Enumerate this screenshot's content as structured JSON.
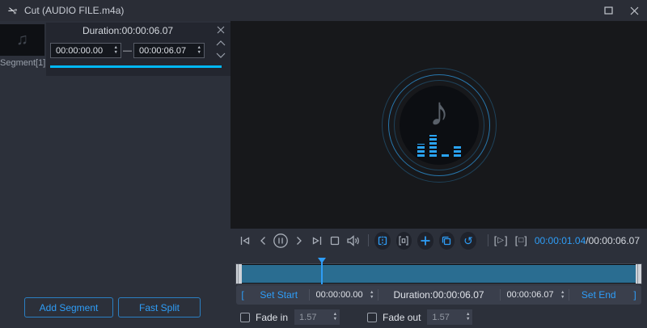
{
  "title_bar": {
    "title": "Cut (AUDIO FILE.m4a)"
  },
  "icons": {
    "scissors": "✂",
    "thumb_note": "♫",
    "preview_note": "♪",
    "spinner_up": "▲",
    "spinner_down": "▼",
    "range_dash": "—",
    "reset": "↺",
    "bracket_open": "[",
    "bracket_close": "]",
    "play_triangle": "▷",
    "stop_square": "□"
  },
  "segment_panel": {
    "segment_label": "Segment[1]",
    "duration_label": "Duration:00:00:06.07",
    "start_value": "00:00:00.00",
    "end_value": "00:00:06.07",
    "add_segment_button": "Add Segment",
    "fast_split_button": "Fast Split"
  },
  "player": {
    "current_time": "00:00:01.04",
    "time_separator": "/",
    "total_time": "00:00:06.07",
    "playhead_percent": 21
  },
  "trim_bar": {
    "set_start_button": "Set Start",
    "start_value": "00:00:00.00",
    "duration_label": "Duration:00:00:06.07",
    "end_value": "00:00:06.07",
    "set_end_button": "Set End"
  },
  "fade_controls": {
    "fade_in_label": "Fade in",
    "fade_in_value": "1.57",
    "fade_out_label": "Fade out",
    "fade_out_value": "1.57"
  },
  "colors": {
    "accent_blue": "#2e9df7",
    "progress_cyan": "#00b8f6",
    "timeline_fill": "#2a6d91",
    "panel_bg": "#2c303a",
    "preview_bg": "#17181b"
  }
}
